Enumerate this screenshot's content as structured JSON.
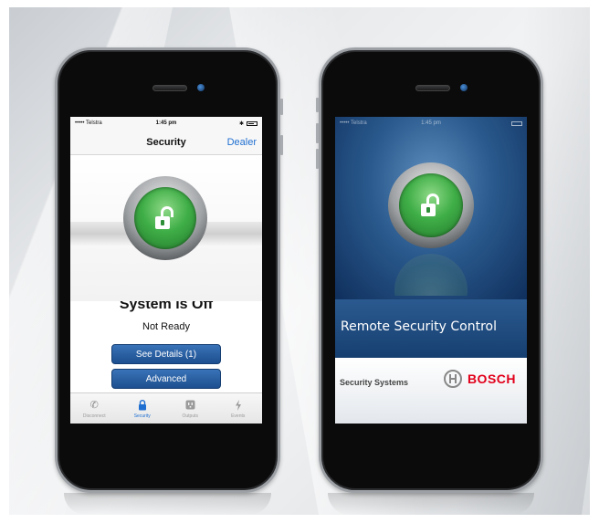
{
  "left_phone": {
    "status_bar": {
      "carrier": "••••• Telstra",
      "time": "1:45 pm"
    },
    "nav": {
      "title": "Security",
      "dealer_label": "Dealer"
    },
    "system_status": "System is Off",
    "ready_status": "Not Ready",
    "buttons": {
      "see_details": "See Details (1)",
      "advanced": "Advanced"
    },
    "tabs": [
      {
        "label": "Disconnect",
        "icon": "phone-icon",
        "active": false
      },
      {
        "label": "Security",
        "icon": "lock-icon",
        "active": true
      },
      {
        "label": "Outputs",
        "icon": "outlet-icon",
        "active": false
      },
      {
        "label": "Events",
        "icon": "lightning-icon",
        "active": false
      }
    ]
  },
  "right_phone": {
    "status_bar": {
      "carrier": "••••• Telstra",
      "time": "1:45 pm"
    },
    "app_title": "Remote Security Control",
    "subtitle": "Security Systems",
    "brand": "BOSCH"
  },
  "colors": {
    "accent_blue": "#1f6fd1",
    "lock_green": "#3fae47",
    "button_blue": "#2a62a6",
    "bosch_red": "#e2001a"
  }
}
